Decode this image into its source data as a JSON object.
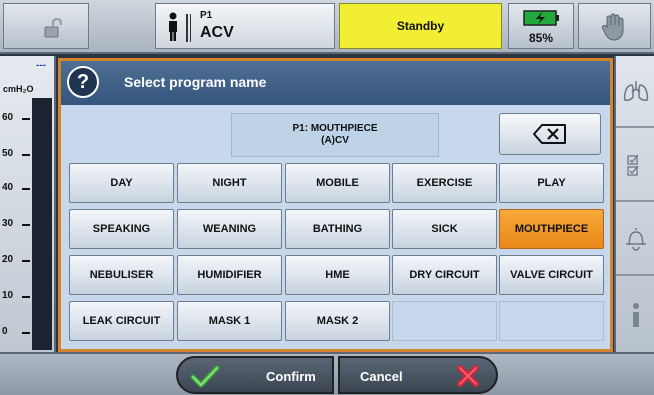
{
  "header": {
    "patient_id": "P1",
    "mode": "ACV",
    "status": "Standby",
    "battery_percent": "85%",
    "status_color": "#f2ee32",
    "lock_icon": "unlock-icon",
    "alarm_icon": "hand-stop-icon"
  },
  "gauge": {
    "value": "---",
    "unit": "cmH₂O",
    "ticks": [
      "60",
      "50",
      "40",
      "30",
      "20",
      "10",
      "0"
    ]
  },
  "dialog": {
    "title": "Select program name",
    "preview_line1": "P1: MOUTHPIECE",
    "preview_line2": "(A)CV",
    "selected_color": "#f0961f",
    "programs": [
      "DAY",
      "NIGHT",
      "MOBILE",
      "EXERCISE",
      "PLAY",
      "SPEAKING",
      "WEANING",
      "BATHING",
      "SICK",
      "MOUTHPIECE",
      "NEBULISER",
      "HUMIDIFIER",
      "HME",
      "DRY CIRCUIT",
      "VALVE CIRCUIT",
      "LEAK CIRCUIT",
      "MASK 1",
      "MASK 2"
    ],
    "selected": "MOUTHPIECE"
  },
  "sidebar": {
    "icons": [
      "lungs-icon",
      "checklist-icon",
      "alarm-bell-icon",
      "info-icon"
    ]
  },
  "footer": {
    "confirm_label": "Confirm",
    "cancel_label": "Cancel"
  }
}
